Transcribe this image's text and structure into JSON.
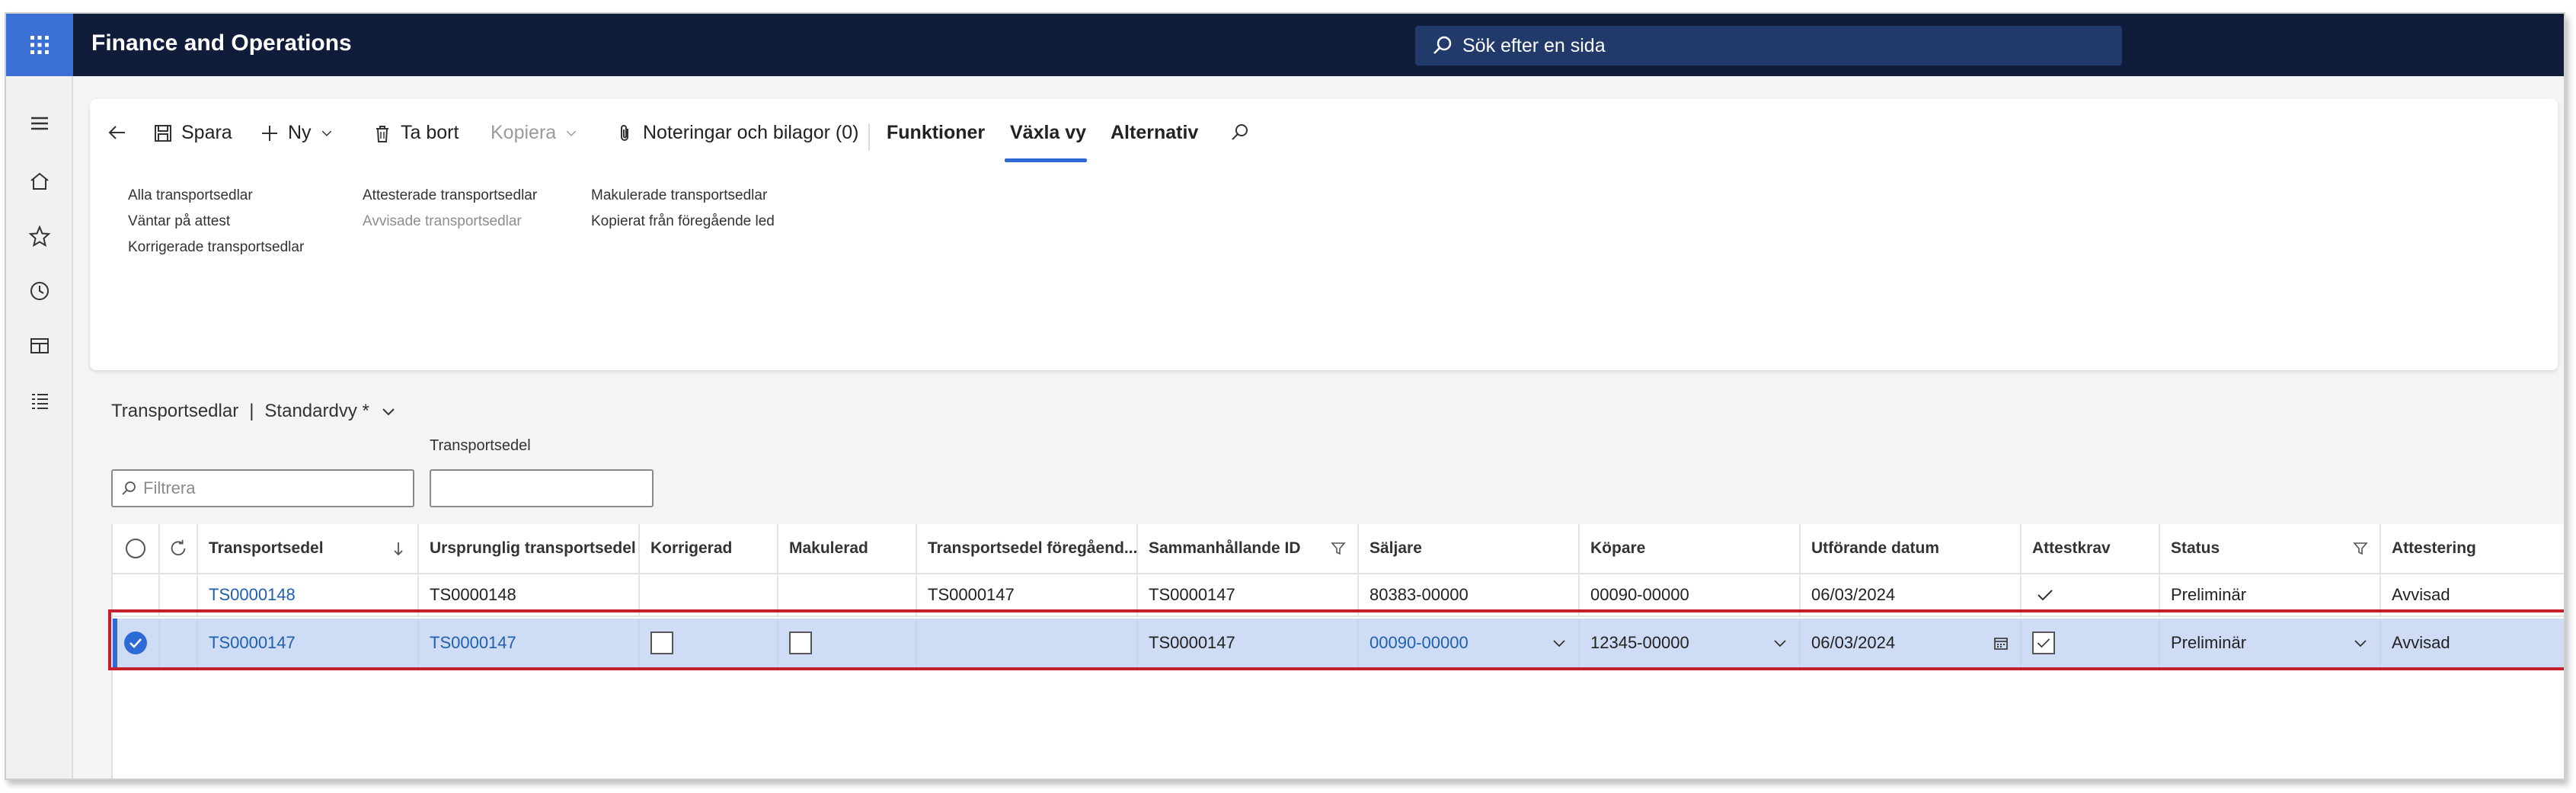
{
  "app": {
    "title": "Finance and Operations",
    "search_placeholder": "Sök efter en sida"
  },
  "left_nav": [
    "hamburger-icon",
    "home-icon",
    "star-icon",
    "clock-icon",
    "workspace-icon",
    "list-icon"
  ],
  "action_pane": {
    "save": "Spara",
    "new": "Ny",
    "delete": "Ta bort",
    "copy": "Kopiera",
    "notes": "Noteringar och bilagor (0)",
    "tab_functions": "Funktioner",
    "tab_switch_view": "Växla vy",
    "tab_options": "Alternativ",
    "links": {
      "col1": [
        "Alla transportsedlar",
        "Väntar på attest",
        "Korrigerade transportsedlar"
      ],
      "col2": [
        "Attesterade transportsedlar",
        "Avvisade transportsedlar"
      ],
      "col3": [
        "Makulerade transportsedlar",
        "Kopierat från föregående led"
      ]
    }
  },
  "list": {
    "breadcrumb_title": "Transportsedlar",
    "separator": "|",
    "view_name": "Standardvy *",
    "filter_placeholder": "Filtrera",
    "field_label": "Transportsedel",
    "columns": [
      "Transportsedel",
      "Ursprunglig transportsedel",
      "Korrigerad",
      "Makulerad",
      "Transportsedel föregåend...",
      "Sammanhållande ID",
      "Säljare",
      "Köpare",
      "Utförande datum",
      "Attestkrav",
      "Status",
      "Attestering"
    ],
    "rows": [
      {
        "transportsedel": "TS0000148",
        "ursprunglig": "TS0000148",
        "foregaende": "TS0000147",
        "sammanhallande": "TS0000147",
        "saljare": "80383-00000",
        "kopare": "00090-00000",
        "datum": "06/03/2024",
        "status": "Preliminär",
        "attestering": "Avvisad"
      },
      {
        "transportsedel": "TS0000147",
        "ursprunglig": "TS0000147",
        "foregaende": "",
        "sammanhallande": "TS0000147",
        "saljare": "00090-00000",
        "kopare": "12345-00000",
        "datum": "06/03/2024",
        "status": "Preliminär",
        "attestering": "Avvisad"
      }
    ]
  },
  "colors": {
    "topbar": "#0f1d3b",
    "accent": "#2f6bd6",
    "selected_row": "#cfdcf5",
    "highlight_border": "#c5202d",
    "link": "#1f5fb0"
  }
}
